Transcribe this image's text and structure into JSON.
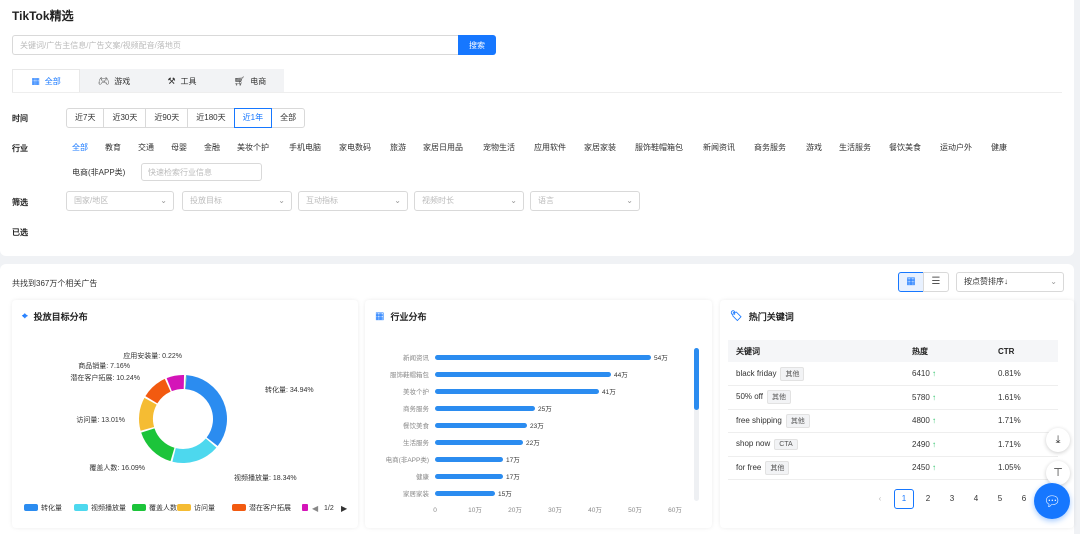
{
  "app": {
    "title": "TikTok精选"
  },
  "search": {
    "placeholder": "关键词/广告主信息/广告文案/视频配音/落地页",
    "button": "搜索"
  },
  "category_tabs": [
    {
      "label": "全部",
      "icon": "grid-icon",
      "active": true
    },
    {
      "label": "游戏",
      "icon": "gamepad-icon",
      "active": false
    },
    {
      "label": "工具",
      "icon": "tools-icon",
      "active": false
    },
    {
      "label": "电商",
      "icon": "cart-icon",
      "active": false
    }
  ],
  "filters": {
    "time_label": "时间",
    "time_options": [
      "近7天",
      "近30天",
      "近90天",
      "近180天",
      "近1年",
      "全部"
    ],
    "time_active": "近1年",
    "industry_label": "行业",
    "industry_options": [
      "全部",
      "教育",
      "交通",
      "母婴",
      "金融",
      "美妆个护",
      "手机电脑",
      "家电数码",
      "旅游",
      "家居日用品",
      "宠物生活",
      "应用软件",
      "家居家装",
      "服饰鞋帽箱包",
      "新闻资讯",
      "商务服务",
      "游戏",
      "生活服务",
      "餐饮美食",
      "运动户外",
      "健康"
    ],
    "industry_extra": "电商(非APP类)",
    "industry_active": "全部",
    "industry_search_placeholder": "快速检索行业信息",
    "screen_label": "筛选",
    "screen_selects": [
      "国家/地区",
      "投放目标",
      "互动指标",
      "视频时长",
      "语言"
    ],
    "selected_label": "已选"
  },
  "results": {
    "count_text": "共找到367万个相关广告",
    "sort_label": "按点赞排序↓"
  },
  "panels": {
    "objective": {
      "title": "投放目标分布",
      "legend_page": "1/2"
    },
    "industry": {
      "title": "行业分布"
    },
    "keywords": {
      "title": "热门关键词"
    }
  },
  "chart_data": [
    {
      "type": "pie",
      "labels": [
        "转化量",
        "视频播放量",
        "覆盖人数",
        "访问量",
        "潜在客户拓展",
        "商品销量",
        "应用安装量"
      ],
      "values": [
        34.94,
        18.34,
        16.09,
        13.01,
        10.24,
        7.16,
        0.22
      ],
      "data_labels": [
        "转化量: 34.94%",
        "视频播放量: 18.34%",
        "覆盖人数: 16.09%",
        "访问量: 13.01%",
        "潜在客户拓展: 10.24%",
        "商品销量: 7.16%",
        "应用安装量: 0.22%"
      ],
      "colors": [
        "#2b8cf0",
        "#4dd8ee",
        "#1cc43a",
        "#f5bc33",
        "#f25a10",
        "#d414b8",
        "#2bb673"
      ],
      "legend": [
        "转化量",
        "视频播放量",
        "覆盖人数",
        "访问量",
        "潜在客户拓展"
      ],
      "legend_placement": "bottom"
    },
    {
      "type": "bar",
      "orientation": "horizontal",
      "categories": [
        "新闻资讯",
        "服饰鞋帽箱包",
        "美妆个护",
        "商务服务",
        "餐饮美食",
        "生活服务",
        "电商(非APP类)",
        "健康",
        "家居家装"
      ],
      "values": [
        54,
        44,
        41,
        25,
        23,
        22,
        17,
        17,
        15
      ],
      "data_labels": [
        "54万",
        "44万",
        "41万",
        "25万",
        "23万",
        "22万",
        "17万",
        "17万",
        "15万"
      ],
      "xlim": [
        0,
        60
      ],
      "xticks": [
        "0",
        "10万",
        "20万",
        "30万",
        "40万",
        "50万",
        "60万"
      ],
      "color": "#2b8cf0"
    }
  ],
  "keywords_table": {
    "columns": [
      "关键词",
      "热度",
      "CTR"
    ],
    "rows": [
      {
        "keyword": "black friday",
        "tag": "其他",
        "heat": "6410",
        "ctr": "0.81%"
      },
      {
        "keyword": "50% off",
        "tag": "其他",
        "heat": "5780",
        "ctr": "1.61%"
      },
      {
        "keyword": "free shipping",
        "tag": "其他",
        "heat": "4800",
        "ctr": "1.71%"
      },
      {
        "keyword": "shop now",
        "tag": "CTA",
        "heat": "2490",
        "ctr": "1.71%"
      },
      {
        "keyword": "for free",
        "tag": "其他",
        "heat": "2450",
        "ctr": "1.05%"
      }
    ],
    "pages": [
      "1",
      "2",
      "3",
      "4",
      "5",
      "6"
    ],
    "current_page": "1"
  },
  "colors": {
    "accent": "#1677ff",
    "up": "#2ec26a"
  }
}
